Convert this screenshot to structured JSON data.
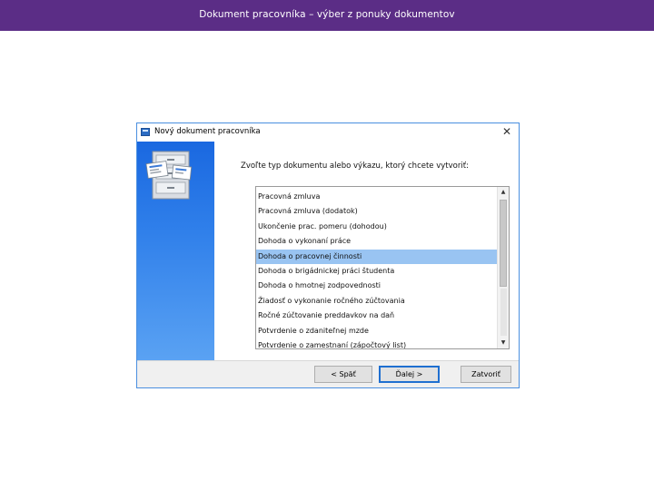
{
  "slide": {
    "title": "Dokument pracovníka – výber z ponuky dokumentov"
  },
  "dialog": {
    "title": "Nový dokument pracovníka",
    "prompt": "Zvoľte typ dokumentu alebo výkazu, ktorý chcete vytvoriť:",
    "icons": {
      "app": "window-app-icon",
      "close": "close-icon",
      "illustration": "document-cabinet-illustration"
    },
    "list": {
      "selected_index": 4,
      "items": [
        "Pracovná zmluva",
        "Pracovná zmluva (dodatok)",
        "Ukončenie prac. pomeru (dohodou)",
        "Dohoda o vykonaní práce",
        "Dohoda o pracovnej činnosti",
        "Dohoda o brigádnickej práci študenta",
        "Dohoda o hmotnej zodpovednosti",
        "Žiadosť o vykonanie ročného zúčtovania",
        "Ročné zúčtovanie preddavkov na daň",
        "Potvrdenie o zdaniteľnej mzde",
        "Potvrdenie o zamestnaní (zápočtový list)"
      ]
    },
    "buttons": {
      "back": "< Späť",
      "next": "Ďalej >",
      "close": "Zatvoriť"
    },
    "colors": {
      "header": "#5b2d86",
      "side_panel": "#2f7fea",
      "selection": "#99c4f2",
      "default_button_border": "#1f6fd0"
    }
  }
}
